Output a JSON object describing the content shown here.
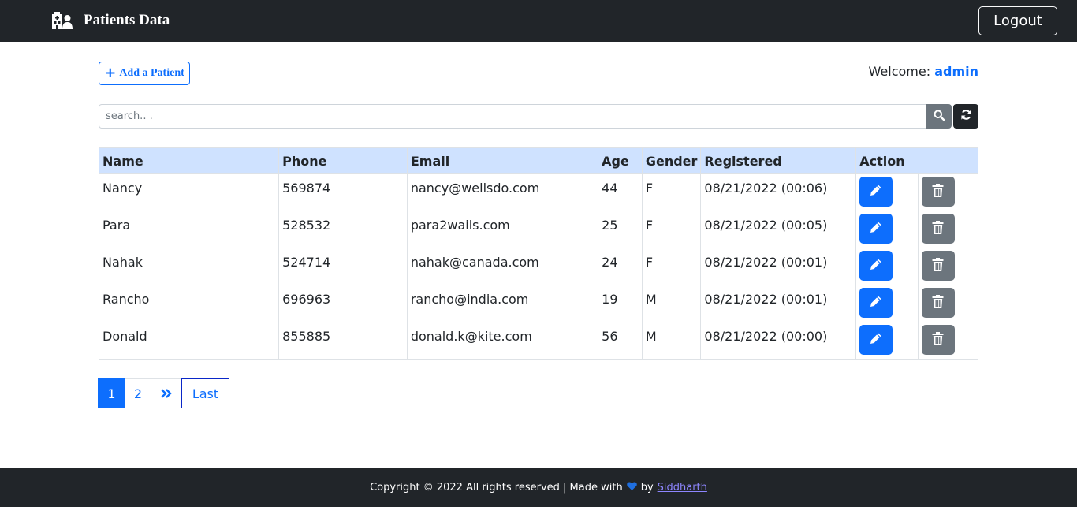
{
  "navbar": {
    "brand_icon": "hospital-user-icon",
    "title": "Patients Data",
    "logout_label": "Logout"
  },
  "toolbar": {
    "add_label": "Add a Patient",
    "add_icon": "plus-icon",
    "welcome_prefix": "Welcome:",
    "username": "admin"
  },
  "search": {
    "placeholder": "search.. .",
    "value": "",
    "search_icon": "search-icon",
    "refresh_icon": "refresh-icon"
  },
  "table": {
    "headers": [
      "Name",
      "Phone",
      "Email",
      "Age",
      "Gender",
      "Registered",
      "Action"
    ],
    "rows": [
      {
        "name": "Nancy",
        "phone": "569874",
        "email": "nancy@wellsdo.com",
        "age": "44",
        "gender": "F",
        "registered": "08/21/2022 (00:06)"
      },
      {
        "name": "Para",
        "phone": "528532",
        "email": "para2wails.com",
        "age": "25",
        "gender": "F",
        "registered": "08/21/2022 (00:05)"
      },
      {
        "name": "Nahak",
        "phone": "524714",
        "email": "nahak@canada.com",
        "age": "24",
        "gender": "F",
        "registered": "08/21/2022 (00:01)"
      },
      {
        "name": "Rancho",
        "phone": "696963",
        "email": "rancho@india.com",
        "age": "19",
        "gender": "M",
        "registered": "08/21/2022 (00:01)"
      },
      {
        "name": "Donald",
        "phone": "855885",
        "email": "donald.k@kite.com",
        "age": "56",
        "gender": "M",
        "registered": "08/21/2022 (00:00)"
      }
    ],
    "edit_icon": "pencil-icon",
    "delete_icon": "trash-icon"
  },
  "pagination": {
    "pages": [
      "1",
      "2"
    ],
    "active_page": "1",
    "next_icon": "double-chevron-right-icon",
    "last_label": "Last"
  },
  "footer": {
    "text": "Copyright © 2022 All rights reserved | Made with",
    "heart_icon": "heart-icon",
    "by": "by",
    "author": "Siddharth"
  },
  "colors": {
    "navbar_bg": "#212529",
    "primary": "#0d6efd",
    "secondary": "#6c757d",
    "table_header_bg": "#cfe2ff",
    "footer_link": "#8e86ff"
  }
}
